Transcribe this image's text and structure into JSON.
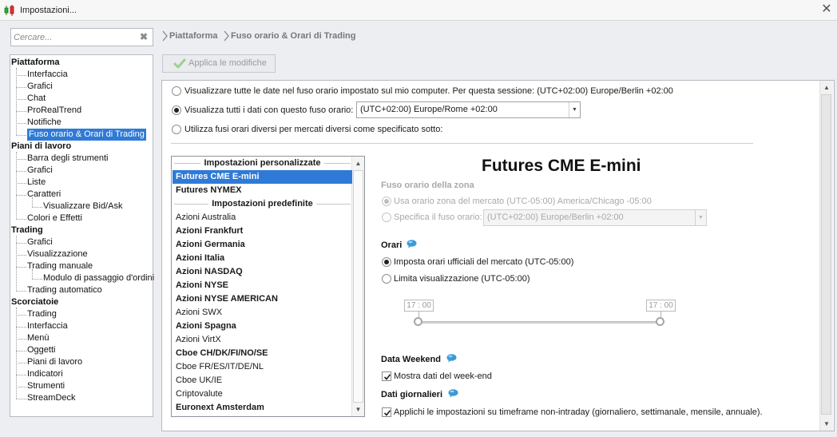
{
  "window": {
    "title": "Impostazioni...",
    "close_icon": "close-icon",
    "app_icon": "candlestick-chart-icon"
  },
  "search": {
    "placeholder": "Cercare...",
    "clear_icon": "clear-search-icon"
  },
  "tree": {
    "categories": [
      {
        "label": "Piattaforma",
        "items": [
          "Interfaccia",
          "Grafici",
          "Chat",
          "ProRealTrend",
          "Notifiche",
          "Fuso orario & Orari di Trading"
        ]
      },
      {
        "label": "Piani di lavoro",
        "items": [
          "Barra degli strumenti",
          "Grafici",
          "Liste",
          "Caratteri",
          "Visualizzare Bid/Ask",
          "Colori e Effetti"
        ]
      },
      {
        "label": "Trading",
        "items": [
          "Grafici",
          "Visualizzazione",
          "Trading manuale",
          "Modulo di passaggio d'ordini",
          "Trading automatico"
        ]
      },
      {
        "label": "Scorciatoie",
        "items": [
          "Trading",
          "Interfaccia",
          "Menù",
          "Oggetti",
          "Piani di lavoro",
          "Indicatori",
          "Strumenti",
          "StreamDeck"
        ]
      }
    ],
    "selected": "Fuso orario & Orari di Trading"
  },
  "breadcrumb": [
    "Piattaforma",
    "Fuso orario & Orari di Trading"
  ],
  "toolbar": {
    "apply_label": "Applica le modifiche",
    "apply_enabled": false
  },
  "timezone_options": {
    "option_computer": "Visualizzare tutte le date nel fuso orario impostato sul mio computer. Per questa sessione: (UTC+02:00) Europe/Berlin +02:00",
    "option_fixed": "Visualizza tutti i dati con questo fuso orario:",
    "option_fixed_value": "(UTC+02:00) Europe/Rome +02:00",
    "option_per_market": "Utilizza fusi orari diversi per mercati diversi come specificato sotto:",
    "selected": "option_fixed"
  },
  "market_list": {
    "header_custom": "Impostazioni personalizzate",
    "header_predefined": "Impostazioni predefinite",
    "custom_items": [
      {
        "label": "Futures CME E-mini",
        "bold": true,
        "selected": true
      },
      {
        "label": "Futures NYMEX",
        "bold": true,
        "selected": false
      }
    ],
    "predefined_items": [
      {
        "label": "Azioni Australia",
        "bold": false
      },
      {
        "label": "Azioni Frankfurt",
        "bold": true
      },
      {
        "label": "Azioni Germania",
        "bold": true
      },
      {
        "label": "Azioni Italia",
        "bold": true
      },
      {
        "label": "Azioni NASDAQ",
        "bold": true
      },
      {
        "label": "Azioni NYSE",
        "bold": true
      },
      {
        "label": "Azioni NYSE AMERICAN",
        "bold": true
      },
      {
        "label": "Azioni SWX",
        "bold": false
      },
      {
        "label": "Azioni Spagna",
        "bold": true
      },
      {
        "label": "Azioni VirtX",
        "bold": false
      },
      {
        "label": "Cboe CH/DK/FI/NO/SE",
        "bold": true
      },
      {
        "label": "Cboe FR/ES/IT/DE/NL",
        "bold": false
      },
      {
        "label": "Cboe UK/IE",
        "bold": false
      },
      {
        "label": "Criptovalute",
        "bold": false
      },
      {
        "label": "Euronext Amsterdam",
        "bold": true
      }
    ]
  },
  "market_detail": {
    "title": "Futures CME E-mini",
    "tz_section_title": "Fuso orario della zona",
    "tz_use_market": "Usa orario zona del mercato (UTC-05:00) America/Chicago -05:00",
    "tz_specify": "Specifica il fuso orario:",
    "tz_specify_value": "(UTC+02:00) Europe/Berlin +02:00",
    "hours_title": "Orari",
    "hours_official": "Imposta orari ufficiali del mercato  (UTC-05:00)",
    "hours_limit": "Limita visualizzazione  (UTC-05:00)",
    "hours_selected": "official",
    "slider_start": "17 : 00",
    "slider_end": "17 : 00",
    "weekend_title": "Data Weekend",
    "weekend_checkbox": "Mostra dati del week-end",
    "weekend_checked": true,
    "daily_title": "Dati giornalieri",
    "daily_checkbox": "Applichi le impostazioni su timeframe non-intraday (giornaliero, settimanale, mensile, annuale).",
    "daily_checked": true,
    "info_icon": "info-bubble-icon"
  },
  "colors": {
    "selection": "#2f7ad6",
    "info_bubble": "#3a9ad9"
  }
}
